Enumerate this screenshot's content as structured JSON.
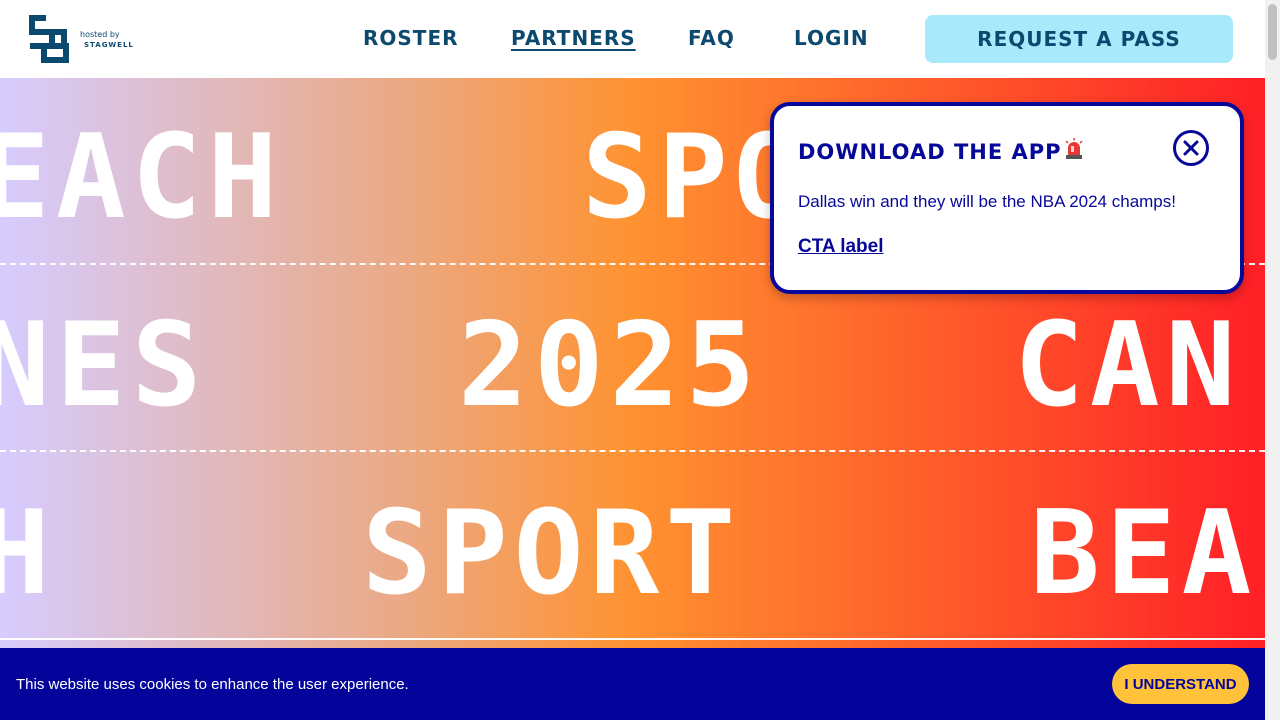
{
  "header": {
    "logo_alt": "SB",
    "hosted_by": "hosted by",
    "host_brand": "STAGWELL",
    "nav": [
      {
        "label": "ROSTER",
        "active": false
      },
      {
        "label": "PARTNERS",
        "active": true
      },
      {
        "label": "FAQ",
        "active": false
      },
      {
        "label": "LOGIN",
        "active": false
      }
    ],
    "cta_label": "REQUEST A PASS"
  },
  "hero": {
    "row1": [
      "EACH",
      "SPO"
    ],
    "row2": [
      "NES",
      "2025",
      "CAN"
    ],
    "row3": [
      "H",
      "SPORT",
      "BEA"
    ]
  },
  "popup": {
    "title": "DOWNLOAD THE APP",
    "icon": "siren-icon",
    "body": "Dallas win and they will be the NBA 2024 champs!",
    "link": "CTA label",
    "close_icon": "close-icon"
  },
  "cookie": {
    "text": "This website uses cookies to enhance the user experience.",
    "button": "I UNDERSTAND"
  },
  "colors": {
    "brand_navy": "#07079a",
    "header_text": "#0b4a6e",
    "cta_bg": "#a8eafc",
    "cookie_bg": "#04049b",
    "cookie_btn": "#ffc23a"
  }
}
